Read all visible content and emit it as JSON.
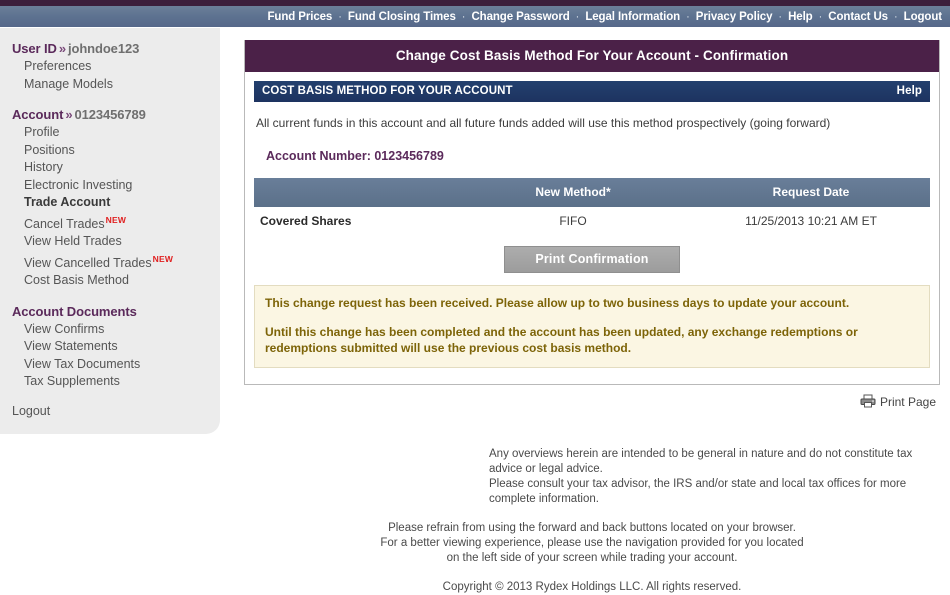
{
  "topnav": {
    "separator": "·",
    "links": [
      "Fund Prices",
      "Fund Closing Times",
      "Change Password",
      "Legal Information",
      "Privacy Policy",
      "Help",
      "Contact Us",
      "Logout"
    ]
  },
  "sidebar": {
    "user_group": {
      "label": "User ID",
      "chevron": "»",
      "value": "johndoe123",
      "items": [
        {
          "label": "Preferences",
          "bold": false,
          "badge": ""
        },
        {
          "label": "Manage Models",
          "bold": false,
          "badge": ""
        }
      ]
    },
    "account_group": {
      "label": "Account",
      "chevron": "»",
      "value": "0123456789",
      "items": [
        {
          "label": "Profile",
          "bold": false,
          "badge": ""
        },
        {
          "label": "Positions",
          "bold": false,
          "badge": ""
        },
        {
          "label": "History",
          "bold": false,
          "badge": ""
        },
        {
          "label": "Electronic Investing",
          "bold": false,
          "badge": ""
        },
        {
          "label": "Trade Account",
          "bold": true,
          "badge": ""
        },
        {
          "label": "Cancel Trades",
          "bold": false,
          "badge": "NEW"
        },
        {
          "label": "View Held Trades",
          "bold": false,
          "badge": ""
        },
        {
          "label": "View Cancelled Trades",
          "bold": false,
          "badge": "NEW"
        },
        {
          "label": "Cost Basis Method",
          "bold": false,
          "badge": ""
        }
      ]
    },
    "documents_group": {
      "label": "Account Documents",
      "items": [
        {
          "label": "View Confirms",
          "bold": false,
          "badge": ""
        },
        {
          "label": "View Statements",
          "bold": false,
          "badge": ""
        },
        {
          "label": "View Tax Documents",
          "bold": false,
          "badge": ""
        },
        {
          "label": "Tax Supplements",
          "bold": false,
          "badge": ""
        }
      ]
    },
    "logout_label": "Logout"
  },
  "panel": {
    "title": "Change Cost Basis Method For Your Account - Confirmation",
    "subheader_title": "COST BASIS METHOD FOR YOUR ACCOUNT",
    "help_label": "Help",
    "intro_text": "All current funds in this account and all future funds added will use this method prospectively (going forward)",
    "account_number_line": "Account Number: 0123456789",
    "table": {
      "headers": [
        "",
        "New Method*",
        "Request Date"
      ],
      "rows": [
        [
          "Covered Shares",
          "FIFO",
          "11/25/2013 10:21 AM ET"
        ]
      ]
    },
    "print_confirmation_label": "Print Confirmation",
    "notice": {
      "line1": "This change request has been received. Please allow up to two business days to update your account.",
      "line2": "Until this change has been completed and the account has been updated, any exchange redemptions or redemptions submitted will use the previous cost basis method."
    }
  },
  "print_page": {
    "label": "Print Page"
  },
  "footer": {
    "disclaimer_line1": "Any overviews herein are intended to be general in nature and do not constitute tax advice or legal advice.",
    "disclaimer_line2": "Please consult your tax advisor, the IRS and/or state and local tax offices for more complete information.",
    "browser_line1": "Please refrain from using the forward and back buttons located on your browser.",
    "browser_line2": "For a better viewing experience, please use the navigation provided for you located",
    "browser_line3": "on the left side of your screen while trading your account.",
    "copyright": "Copyright © 2013 Rydex Holdings LLC. All rights reserved."
  },
  "colors": {
    "top_strip": "#3c1f3c",
    "nav_bar": "#5f7490",
    "panel_title": "#4b2148",
    "sub_header": "#1f3864",
    "table_header": "#5f7490",
    "notice_bg": "#fbf6e3",
    "notice_text": "#7d6408",
    "badge_new": "#e02020",
    "sidebar_bg": "#ececec",
    "accent_purple": "#5b2a5b"
  }
}
